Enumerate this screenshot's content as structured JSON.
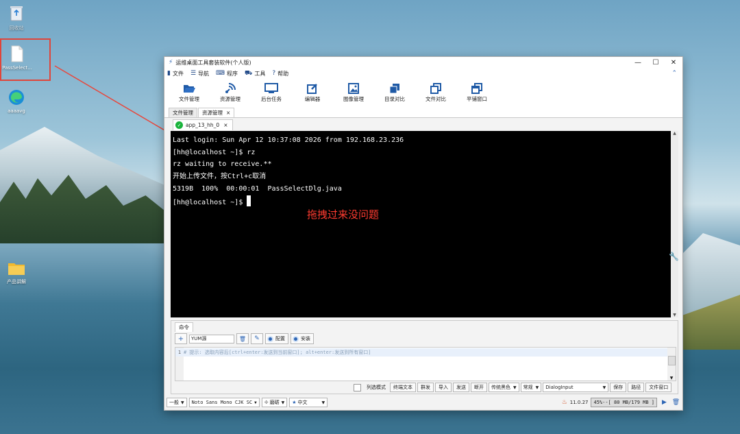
{
  "desktop": {
    "icons": [
      {
        "label": "回收站",
        "icon": "recycle-bin-icon"
      },
      {
        "label": "PassSelect...",
        "icon": "file-icon"
      },
      {
        "label": "aaaavg",
        "icon": "edge-icon"
      },
      {
        "label": "产品讲解",
        "icon": "folder-icon"
      }
    ],
    "annotation": "拖拽过来没问题",
    "annotation_color": "#ff3b30"
  },
  "window": {
    "title": "运维桌面工具套装软件(个人版)",
    "menu": [
      {
        "label": "文件",
        "icon": "file-icon"
      },
      {
        "label": "导航",
        "icon": "menu-icon"
      },
      {
        "label": "程序",
        "icon": "keyboard-icon"
      },
      {
        "label": "工具",
        "icon": "toolbox-icon"
      },
      {
        "label": "帮助",
        "icon": "help-icon"
      }
    ],
    "tools": [
      {
        "label": "文件管理",
        "icon": "folder-open-icon"
      },
      {
        "label": "资源管理",
        "icon": "satellite-icon"
      },
      {
        "label": "后台任务",
        "icon": "monitor-icon"
      },
      {
        "label": "编辑器",
        "icon": "edit-icon"
      },
      {
        "label": "图像管理",
        "icon": "image-icon"
      },
      {
        "label": "目录对比",
        "icon": "copy-dir-icon"
      },
      {
        "label": "文件对比",
        "icon": "copy-file-icon"
      },
      {
        "label": "平铺窗口",
        "icon": "windows-icon"
      }
    ],
    "tabs": [
      {
        "label": "文件管理"
      },
      {
        "label": "资源管理",
        "close": "×"
      }
    ],
    "session_tab": {
      "label": "app_13_hh_0",
      "close": "×"
    },
    "terminal": {
      "lines": [
        "Last login: Sun Apr 12 10:37:08 2026 from 192.168.23.236",
        "[hh@localhost ~]$ rz",
        "rz waiting to receive.**",
        "开始上传文件，按Ctrl+c取消",
        "5319B  100%  00:00:01  PassSelectDlg.java",
        "[hh@localhost ~]$ "
      ]
    },
    "command_panel": {
      "tab": "命令",
      "yum_value": "YUM源",
      "config_label": "配置",
      "install_label": "安装",
      "editor_line_no": "1",
      "editor_hint": "# 提示: 选取内容后[ctrl+enter:发送到当前窗口]; alt+enter:发送到所有窗口]",
      "options": {
        "column_mode": "列选模式",
        "terminal_text": "终端文本",
        "broadcast": "群发",
        "import": "导入",
        "send": "发送",
        "disconnect": "断开",
        "color_scheme": "传统黑色",
        "mode": "常规",
        "dialog": "DialogInput",
        "save": "保存",
        "path": "路径",
        "file_window": "文件窗口"
      }
    },
    "statusbar": {
      "size": "一般",
      "font": "Noto Sans Mono CJK SC",
      "theme": "磨砺",
      "language": "中文",
      "version": "11.0.27",
      "memory": "45%--[ 80 MB/179 MB ]"
    }
  }
}
